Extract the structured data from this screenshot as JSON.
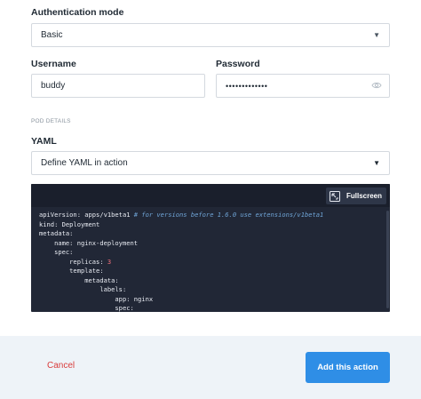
{
  "auth": {
    "mode_label": "Authentication mode",
    "mode_value": "Basic",
    "username_label": "Username",
    "username_value": "buddy",
    "password_label": "Password",
    "password_value": "•••••••••••••"
  },
  "pod": {
    "section_title": "POD DETAILS",
    "yaml_label": "YAML",
    "yaml_select_value": "Define YAML in action"
  },
  "editor": {
    "fullscreen_label": "Fullscreen",
    "lines": [
      {
        "text": "apiVersion: apps/v1beta1 ",
        "comment": "# for versions before 1.6.0 use extensions/v1beta1"
      },
      {
        "text": "kind: Deployment"
      },
      {
        "text": "metadata:"
      },
      {
        "text": "    name: nginx-deployment"
      },
      {
        "text": "    spec:"
      },
      {
        "text": "        replicas: ",
        "number": "3"
      },
      {
        "text": "        template:"
      },
      {
        "text": "            metadata:"
      },
      {
        "text": "                labels:"
      },
      {
        "text": "                    app: nginx"
      },
      {
        "text": "                    spec:"
      }
    ]
  },
  "footer": {
    "cancel_label": "Cancel",
    "submit_label": "Add this action"
  },
  "colors": {
    "accent": "#2f8ee6",
    "danger": "#d93c3c",
    "editor_bg": "#212736"
  }
}
